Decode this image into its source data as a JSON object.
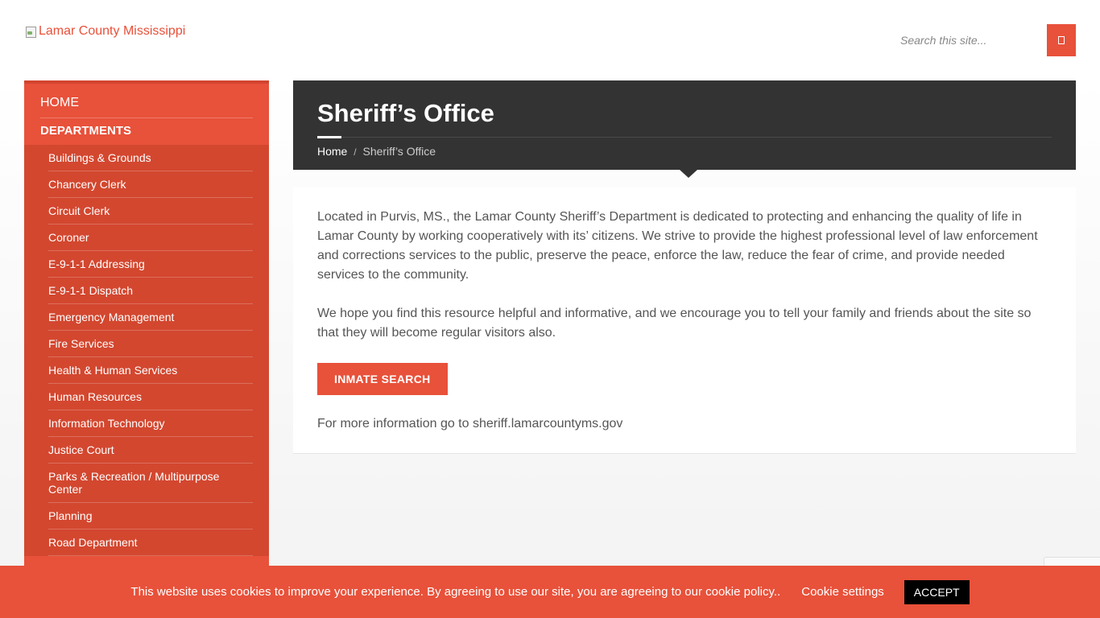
{
  "header": {
    "logo_alt": "Lamar County Mississippi",
    "search_placeholder": "Search this site...",
    "search_button_icon": "search-icon"
  },
  "sidebar": {
    "home_label": "HOME",
    "departments_label": "DEPARTMENTS",
    "items": [
      "Buildings & Grounds",
      "Chancery Clerk",
      "Circuit Clerk",
      "Coroner",
      "E-9-1-1 Addressing",
      "E-9-1-1 Dispatch",
      "Emergency Management",
      "Fire Services",
      "Health & Human Services",
      "Human Resources",
      "Information Technology",
      "Justice Court",
      "Parks & Recreation / Multipurpose Center",
      "Planning",
      "Road Department"
    ]
  },
  "page": {
    "title": "Sheriff’s Office",
    "breadcrumb": {
      "home": "Home",
      "separator": "/",
      "current": "Sheriff’s Office"
    }
  },
  "content": {
    "paragraph1": "Located in Purvis, MS., the Lamar County Sheriff’s Department is dedicated to protecting and enhancing the quality of life in Lamar County by working cooperatively with its’ citizens. We strive to provide the highest professional level of law enforcement and corrections services to the public, preserve the peace, enforce the law, reduce the fear of crime, and provide needed services to the community.",
    "paragraph2": "We hope you find this resource helpful and informative, and we encourage you to tell your family and friends about the site so that they will become regular visitors also.",
    "button_label": "INMATE SEARCH",
    "more_info": "For more information go to sheriff.lamarcountyms.gov"
  },
  "cookie": {
    "text": "This website uses cookies to improve your experience. By agreeing to use our site, you are agreeing to our cookie policy..",
    "settings_label": "Cookie settings",
    "accept_label": "ACCEPT"
  },
  "colors": {
    "accent": "#e8513a",
    "accent_dark": "#d3472f",
    "title_band": "#333333"
  }
}
